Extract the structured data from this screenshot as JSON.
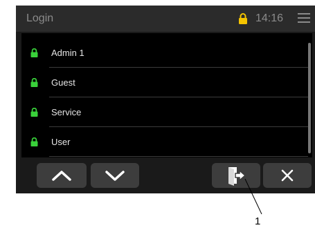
{
  "header": {
    "title": "Login",
    "time": "14:16"
  },
  "users": [
    {
      "label": "Admin 1"
    },
    {
      "label": "Guest"
    },
    {
      "label": "Service"
    },
    {
      "label": "User"
    }
  ],
  "icons": {
    "header_lock": "lock-icon",
    "row_lock": "lock-icon",
    "menu": "hamburger-menu-icon",
    "up": "chevron-up-icon",
    "down": "chevron-down-icon",
    "login": "door-enter-icon",
    "close": "close-icon"
  },
  "colors": {
    "header_lock": "#f5c400",
    "row_lock": "#39d13a",
    "background": "#1a1a1a",
    "list": "#000000",
    "button": "#3d3d3d"
  },
  "callout": {
    "label": "1"
  }
}
